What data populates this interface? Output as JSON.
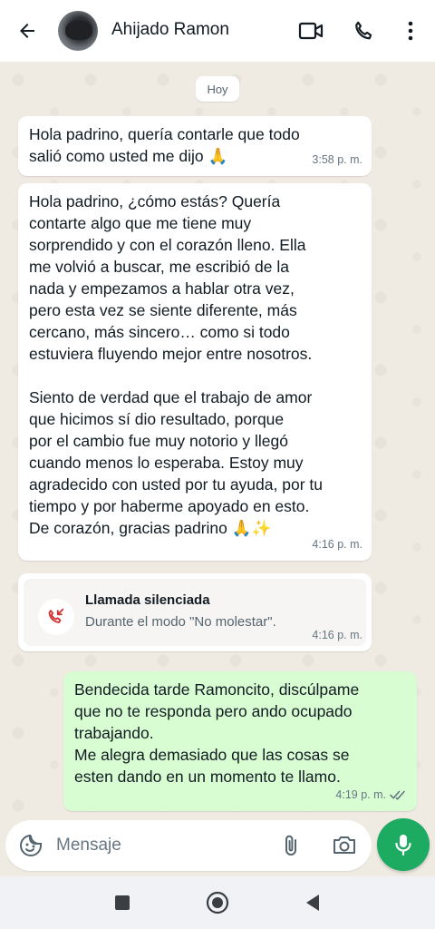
{
  "header": {
    "contact_name": "Ahijado Ramon"
  },
  "chat": {
    "date_label": "Hoy",
    "messages": [
      {
        "direction": "in",
        "text": "Hola padrino, quería contarle que todo\nsalió como usted me dijo 🙏",
        "time": "3:58 p. m."
      },
      {
        "direction": "in",
        "text": "Hola padrino, ¿cómo estás? Quería\ncontarte algo que me tiene muy\nsorprendido y con el corazón lleno. Ella\nme volvió a buscar, me escribió de la\nnada y empezamos a hablar otra vez,\npero esta vez se siente diferente, más\ncercano, más sincero… como si todo\nestuviera fluyendo mejor entre nosotros.\n\nSiento de verdad que el trabajo de amor\nque hicimos sí dio resultado, porque\npor el cambio fue muy notorio y llegó\ncuando menos lo esperaba. Estoy muy\nagradecido con usted por tu ayuda, por tu\ntiempo y por haberme apoyado en esto.\nDe corazón, gracias padrino 🙏✨",
        "time": "4:16 p. m."
      },
      {
        "direction": "in",
        "type": "missed_call",
        "title": "Llamada silenciada",
        "subtitle": "Durante el modo \"No molestar\".",
        "time": "4:16 p. m."
      },
      {
        "direction": "out",
        "text": "Bendecida tarde Ramoncito, discúlpame\nque no te responda pero ando ocupado\ntrabajando.\nMe alegra demasiado que las cosas se\nesten dando en un momento te llamo.",
        "time": "4:19 p. m.",
        "status": "read"
      }
    ]
  },
  "composer": {
    "placeholder": "Mensaje"
  },
  "colors": {
    "chat_background": "#efeae2",
    "outgoing_bubble": "#d9fdd3",
    "incoming_bubble": "#ffffff",
    "accent_green": "#1daa61",
    "missed_call_red": "#d32f2f"
  },
  "icons": {
    "back": "arrow-left-icon",
    "video": "video-camera-icon",
    "call": "phone-icon",
    "menu": "kebab-menu-icon",
    "emoji": "sticker-smiley-icon",
    "attach": "paperclip-icon",
    "camera": "camera-icon",
    "mic": "microphone-icon",
    "missed_call": "missed-call-icon",
    "read_receipt": "double-check-icon"
  }
}
